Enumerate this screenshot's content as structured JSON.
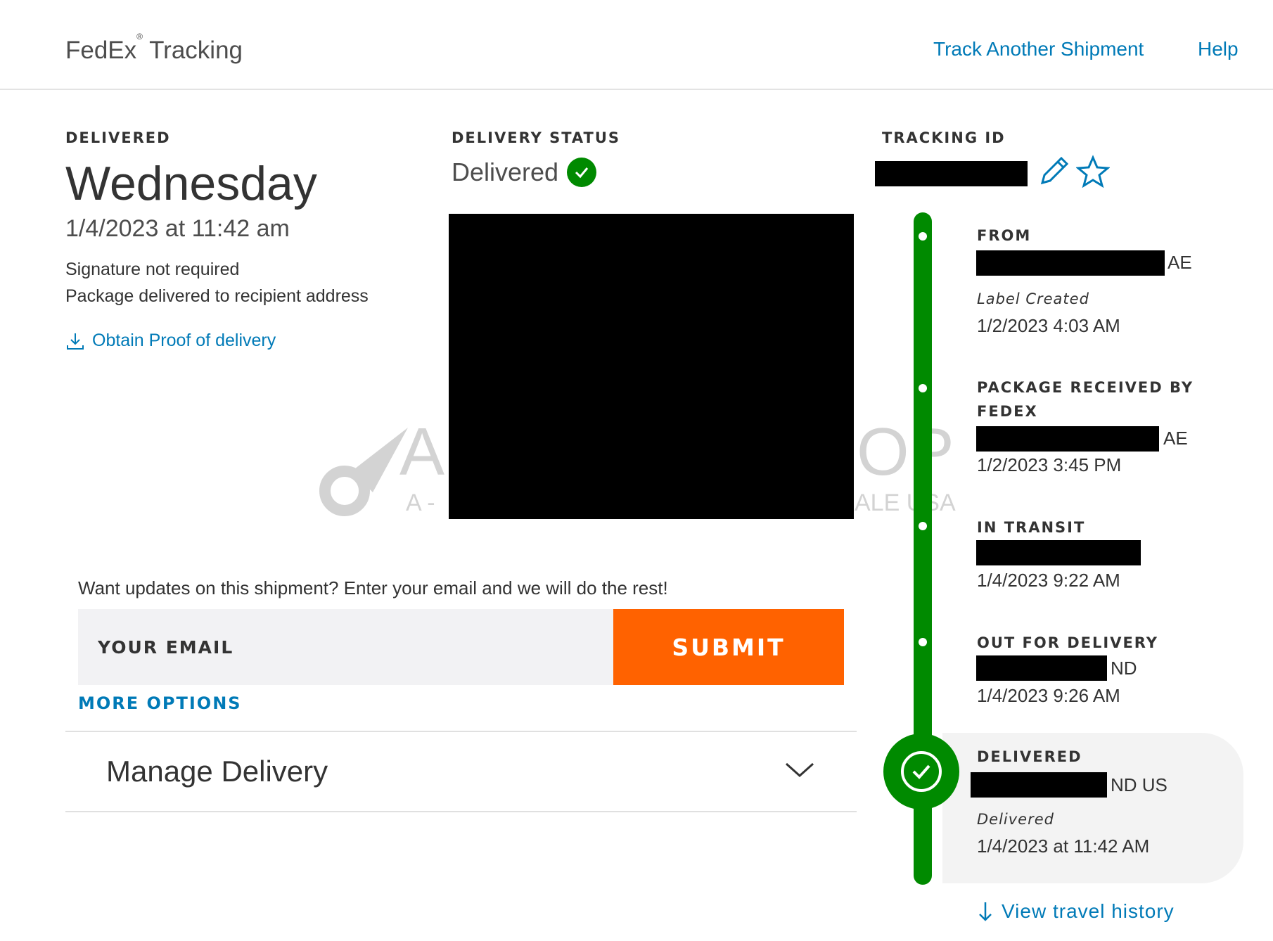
{
  "header": {
    "brand": "FedEx",
    "brand_mark": "®",
    "brand_suffix": "Tracking",
    "nav": {
      "track_another": "Track Another Shipment",
      "help": "Help"
    }
  },
  "summary": {
    "eyebrow": "DELIVERED",
    "day": "Wednesday",
    "datetime": "1/4/2023 at 11:42 am",
    "notes": [
      "Signature not required",
      "Package delivered to recipient address"
    ],
    "proof_link": "Obtain Proof of delivery",
    "proof_icon": "download-icon"
  },
  "status": {
    "eyebrow": "DELIVERY STATUS",
    "value": "Delivered",
    "icon": "check-circle-icon",
    "accent": "#008a00"
  },
  "watermark": {
    "big_left": "A",
    "big_right": "OP",
    "sub_left": "A - ",
    "sub_right": "ALE USA"
  },
  "email": {
    "prompt": "Want updates on this shipment? Enter your email and we will do the rest!",
    "placeholder": "YOUR EMAIL",
    "submit": "SUBMIT",
    "submit_color": "#ff6200",
    "more_options": "MORE OPTIONS"
  },
  "manage": {
    "label": "Manage Delivery",
    "icon": "chevron-down-icon"
  },
  "tracking": {
    "eyebrow": "TRACKING ID",
    "edit_icon": "pencil-icon",
    "favorite_icon": "star-icon"
  },
  "timeline": {
    "events": [
      {
        "title": "FROM",
        "location_suffix": "AE",
        "status": "Label Created",
        "date": "1/2/2023 4:03 AM"
      },
      {
        "title_line1": "PACKAGE RECEIVED BY",
        "title_line2": "FEDEX",
        "location_suffix": "AE",
        "date": "1/2/2023 3:45 PM"
      },
      {
        "title": "IN TRANSIT",
        "date": "1/4/2023 9:22 AM"
      },
      {
        "title": "OUT FOR DELIVERY",
        "location_suffix": "ND",
        "date": "1/4/2023 9:26 AM"
      },
      {
        "title": "DELIVERED",
        "location_suffix": "ND US",
        "status": "Delivered",
        "date": "1/4/2023 at 11:42 AM"
      }
    ],
    "travel_history": "View travel history",
    "travel_icon": "arrow-down-icon"
  }
}
